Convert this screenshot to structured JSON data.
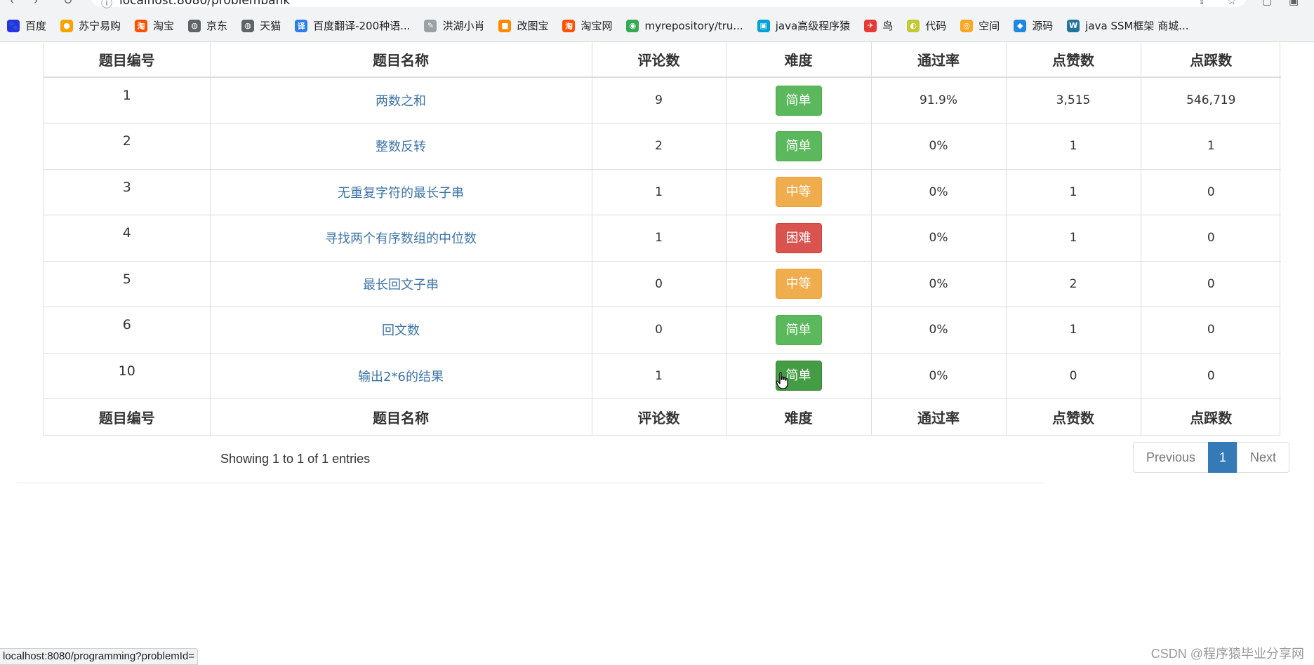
{
  "browser": {
    "url": "localhost:8080/problembank",
    "bookmarks": [
      {
        "label": "百度",
        "icon": "baidu-paw-icon",
        "color": "#2932e1",
        "glyph": "🐾"
      },
      {
        "label": "苏宁易购",
        "icon": "suning-icon",
        "color": "#f7a400",
        "glyph": "●"
      },
      {
        "label": "淘宝",
        "icon": "taobao-icon",
        "color": "#ff5000",
        "glyph": "淘"
      },
      {
        "label": "京东",
        "icon": "globe-icon",
        "color": "#5f6368",
        "glyph": "◍"
      },
      {
        "label": "天猫",
        "icon": "globe-icon",
        "color": "#5f6368",
        "glyph": "◍"
      },
      {
        "label": "百度翻译-200种语...",
        "icon": "translate-icon",
        "color": "#2b7de9",
        "glyph": "译"
      },
      {
        "label": "洪湖小肖",
        "icon": "feather-icon",
        "color": "#9aa0a6",
        "glyph": "✎"
      },
      {
        "label": "改图宝",
        "icon": "gaitubao-icon",
        "color": "#ff8a00",
        "glyph": "■"
      },
      {
        "label": "淘宝网",
        "icon": "taobao-icon",
        "color": "#ff5000",
        "glyph": "淘"
      },
      {
        "label": "myrepository/tru...",
        "icon": "chrome-icon",
        "color": "#34a853",
        "glyph": "◉"
      },
      {
        "label": "java高级程序猿",
        "icon": "bilibili-icon",
        "color": "#00a1d6",
        "glyph": "▣"
      },
      {
        "label": "鸟",
        "icon": "bird-icon",
        "color": "#e53935",
        "glyph": "✈"
      },
      {
        "label": "代码",
        "icon": "code-icon",
        "color": "#c0ca33",
        "glyph": "◐"
      },
      {
        "label": "空间",
        "icon": "qzone-icon",
        "color": "#f9a825",
        "glyph": "◎"
      },
      {
        "label": "源码",
        "icon": "whale-icon",
        "color": "#1e88e5",
        "glyph": "◆"
      },
      {
        "label": "java SSM框架 商城...",
        "icon": "wordpress-icon",
        "color": "#21759b",
        "glyph": "W"
      }
    ]
  },
  "table": {
    "headers": [
      "题目编号",
      "题目名称",
      "评论数",
      "难度",
      "通过率",
      "点赞数",
      "点踩数"
    ],
    "rows": [
      {
        "id": "1",
        "name": "两数之和",
        "comments": "9",
        "difficulty": "简单",
        "level": "easy",
        "pass_rate": "91.9%",
        "likes": "3,515",
        "dislikes": "546,719"
      },
      {
        "id": "2",
        "name": "整数反转",
        "comments": "2",
        "difficulty": "简单",
        "level": "easy",
        "pass_rate": "0%",
        "likes": "1",
        "dislikes": "1"
      },
      {
        "id": "3",
        "name": "无重复字符的最长子串",
        "comments": "1",
        "difficulty": "中等",
        "level": "medium",
        "pass_rate": "0%",
        "likes": "1",
        "dislikes": "0"
      },
      {
        "id": "4",
        "name": "寻找两个有序数组的中位数",
        "comments": "1",
        "difficulty": "困难",
        "level": "hard",
        "pass_rate": "0%",
        "likes": "1",
        "dislikes": "0"
      },
      {
        "id": "5",
        "name": "最长回文子串",
        "comments": "0",
        "difficulty": "中等",
        "level": "medium",
        "pass_rate": "0%",
        "likes": "2",
        "dislikes": "0"
      },
      {
        "id": "6",
        "name": "回文数",
        "comments": "0",
        "difficulty": "简单",
        "level": "easy",
        "pass_rate": "0%",
        "likes": "1",
        "dislikes": "0"
      },
      {
        "id": "10",
        "name": "输出2*6的结果",
        "comments": "1",
        "difficulty": "简单",
        "level": "easy",
        "pass_rate": "0%",
        "likes": "0",
        "dislikes": "0",
        "hovered": true
      }
    ],
    "info": "Showing 1 to 1 of 1 entries",
    "pagination": {
      "previous": "Previous",
      "current": "1",
      "next": "Next"
    }
  },
  "status_bar": "localhost:8080/programming?problemId=",
  "watermark": "CSDN @程序猿毕业分享网",
  "colors": {
    "easy": "#5cb85c",
    "medium": "#f0ad4e",
    "hard": "#d9534f",
    "link": "#3d74a8",
    "page_active": "#337ab7"
  }
}
